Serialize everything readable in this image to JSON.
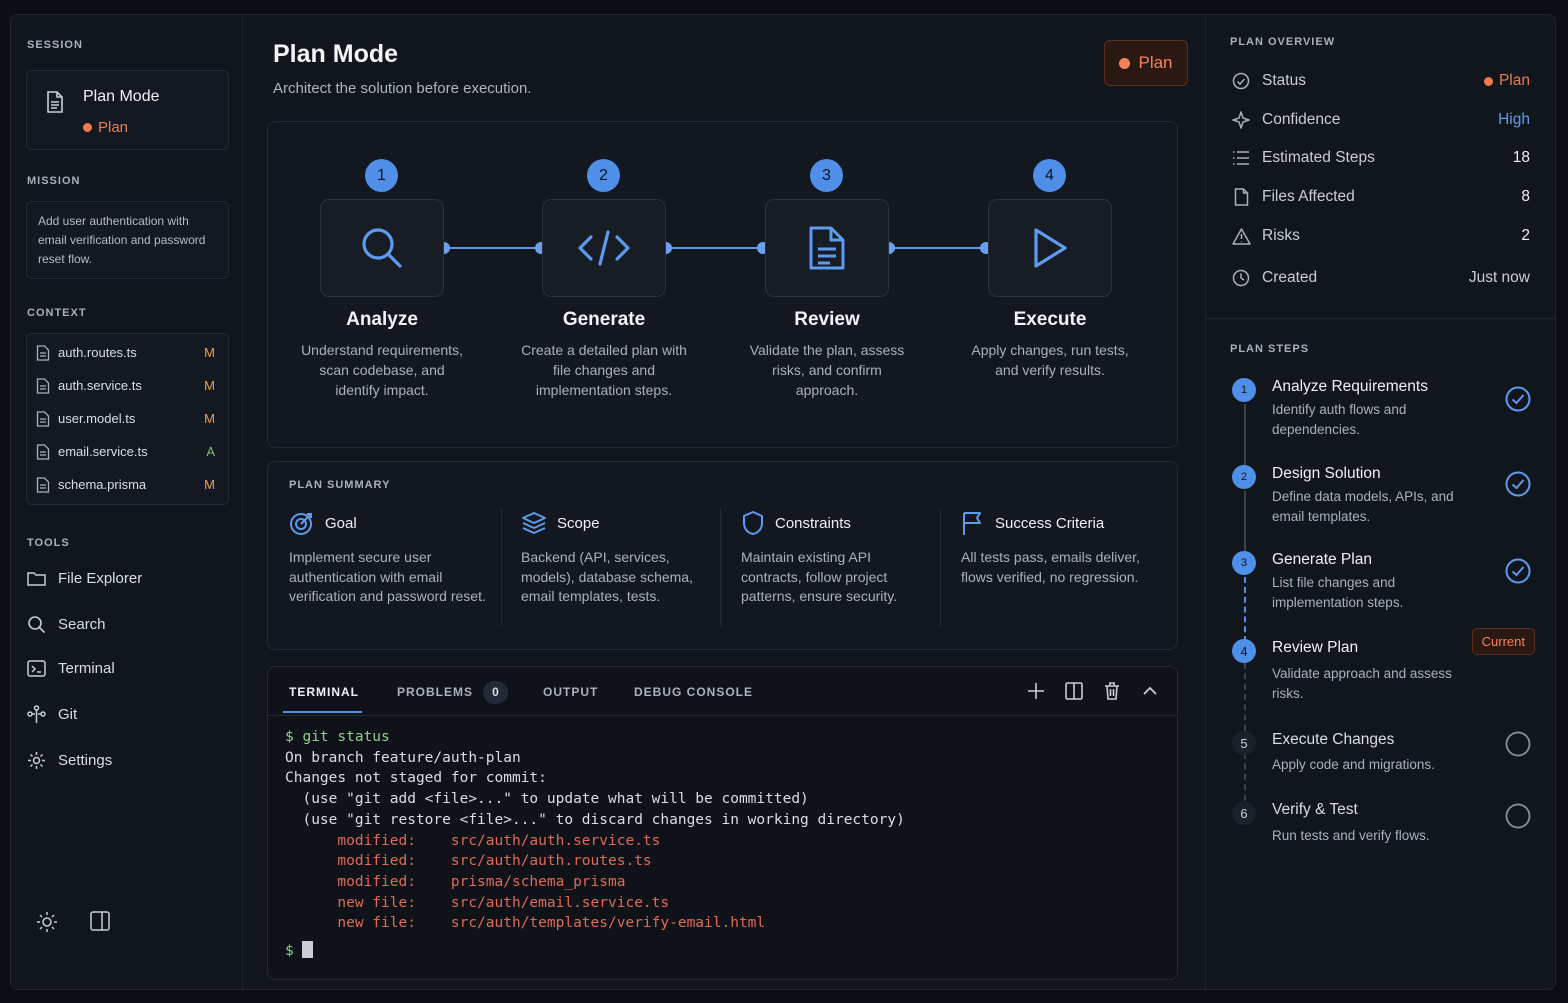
{
  "sidebar": {
    "session_label": "SESSION",
    "session_title": "Plan Mode",
    "session_status": "Plan",
    "mission_label": "MISSION",
    "mission_text": "Add user authentication with email verification and password reset flow.",
    "context_label": "CONTEXT",
    "context_files": [
      {
        "name": "auth.routes.ts",
        "flag": "M"
      },
      {
        "name": "auth.service.ts",
        "flag": "M"
      },
      {
        "name": "user.model.ts",
        "flag": "M"
      },
      {
        "name": "email.service.ts",
        "flag": "A"
      },
      {
        "name": "schema.prisma",
        "flag": "M"
      }
    ],
    "tools_label": "TOOLS",
    "tools": [
      {
        "label": "File Explorer",
        "icon": "folder-icon"
      },
      {
        "label": "Search",
        "icon": "search-icon"
      },
      {
        "label": "Terminal",
        "icon": "terminal-icon"
      },
      {
        "label": "Git",
        "icon": "git-icon"
      },
      {
        "label": "Settings",
        "icon": "gear-icon"
      }
    ],
    "bottom_icons": [
      "sun-icon",
      "panel-toggle-icon"
    ]
  },
  "main": {
    "title": "Plan Mode",
    "subtitle": "Architect the solution before execution.",
    "mode_badge": "Plan",
    "stages": [
      {
        "num": "1",
        "title": "Analyze",
        "desc": "Understand requirements, scan codebase, and identify impact.",
        "icon": "search-icon"
      },
      {
        "num": "2",
        "title": "Generate",
        "desc": "Create a detailed plan with file changes and implementation steps.",
        "icon": "code-icon"
      },
      {
        "num": "3",
        "title": "Review",
        "desc": "Validate the plan, assess risks, and confirm approach.",
        "icon": "document-icon"
      },
      {
        "num": "4",
        "title": "Execute",
        "desc": "Apply changes, run tests, and verify results.",
        "icon": "play-icon"
      }
    ],
    "summary": {
      "label": "PLAN SUMMARY",
      "items": [
        {
          "title": "Goal",
          "text": "Implement secure user authentication with email verification and password reset.",
          "icon": "target-icon"
        },
        {
          "title": "Scope",
          "text": "Backend (API, services, models), database schema, email templates, tests.",
          "icon": "layers-icon"
        },
        {
          "title": "Constraints",
          "text": "Maintain existing API contracts, follow project patterns, ensure security.",
          "icon": "shield-icon"
        },
        {
          "title": "Success Criteria",
          "text": "All tests pass, emails deliver, flows verified, no regression.",
          "icon": "flag-icon"
        }
      ]
    },
    "terminal": {
      "tabs": [
        "TERMINAL",
        "PROBLEMS",
        "OUTPUT",
        "DEBUG CONSOLE"
      ],
      "problems_count": "0",
      "lines": {
        "cmd": "$ git status",
        "l1": "On branch feature/auth-plan",
        "l2": "Changes not staged for commit:",
        "l3": "  (use \"git add <file>...\" to update what will be committed)",
        "l4": "  (use \"git restore <file>...\" to discard changes in working directory)",
        "m1": "      modified:    src/auth/auth.service.ts",
        "m2": "      modified:    src/auth/auth.routes.ts",
        "m3": "      modified:    prisma/schema_prisma",
        "n1": "      new file:    src/auth/email.service.ts",
        "n2": "      new file:    src/auth/templates/verify-email.html",
        "prompt": "$"
      }
    }
  },
  "overview": {
    "label": "PLAN OVERVIEW",
    "rows": [
      {
        "label": "Status",
        "value": "Plan",
        "icon": "status-icon"
      },
      {
        "label": "Confidence",
        "value": "High",
        "icon": "sparkle-icon"
      },
      {
        "label": "Estimated Steps",
        "value": "18",
        "icon": "list-icon"
      },
      {
        "label": "Files Affected",
        "value": "8",
        "icon": "file-icon"
      },
      {
        "label": "Risks",
        "value": "2",
        "icon": "warning-icon"
      },
      {
        "label": "Created",
        "value": "Just now",
        "icon": "clock-icon"
      }
    ]
  },
  "steps": {
    "label": "PLAN STEPS",
    "items": [
      {
        "num": "1",
        "title": "Analyze Requirements",
        "desc": "Identify auth flows and dependencies.",
        "state": "done"
      },
      {
        "num": "2",
        "title": "Design Solution",
        "desc": "Define data models, APIs, and email templates.",
        "state": "done"
      },
      {
        "num": "3",
        "title": "Generate Plan",
        "desc": "List file changes and implementation steps.",
        "state": "done"
      },
      {
        "num": "4",
        "title": "Review Plan",
        "desc": "Validate approach and assess risks.",
        "state": "current",
        "badge": "Current"
      },
      {
        "num": "5",
        "title": "Execute Changes",
        "desc": "Apply code and migrations.",
        "state": "pending"
      },
      {
        "num": "6",
        "title": "Verify & Test",
        "desc": "Run tests and verify flows.",
        "state": "pending"
      }
    ]
  },
  "colors": {
    "accent": "#4f8fe8",
    "plan_orange": "#f07a4f",
    "modified_flag": "#e8a24a",
    "added_flag": "#7cc06a",
    "terminal_red": "#e06a55",
    "terminal_green": "#8fd08a"
  }
}
